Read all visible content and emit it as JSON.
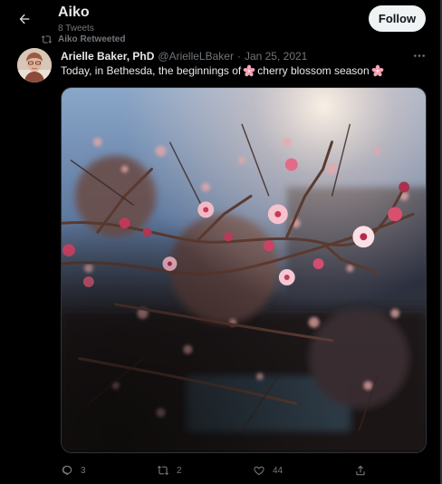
{
  "header": {
    "title": "Aiko",
    "subtitle": "8 Tweets",
    "follow_label": "Follow"
  },
  "retweet": {
    "label": "Aiko Retweeted"
  },
  "tweet": {
    "author_name": "Arielle Baker, PhD",
    "handle": "@ArielleLBaker",
    "separator": "·",
    "date": "Jan 25, 2021",
    "text_before": "Today, in Bethesda, the beginnings of",
    "text_middle": "cherry blossom season",
    "emoji": "cherry-blossom-icon",
    "photo_alt": "Cherry blossom branches in sunlight"
  },
  "actions": {
    "replies": "3",
    "retweets": "2",
    "likes": "44"
  },
  "colors": {
    "background": "#000000",
    "text_primary": "#e7e9ea",
    "text_secondary": "#71767b",
    "follow_bg": "#eff3f4",
    "blossom_pink": "#f4a7bd"
  },
  "icons": [
    "back-arrow-icon",
    "retweet-icon",
    "more-icon",
    "reply-icon",
    "like-icon",
    "share-icon",
    "cherry-blossom-icon"
  ]
}
